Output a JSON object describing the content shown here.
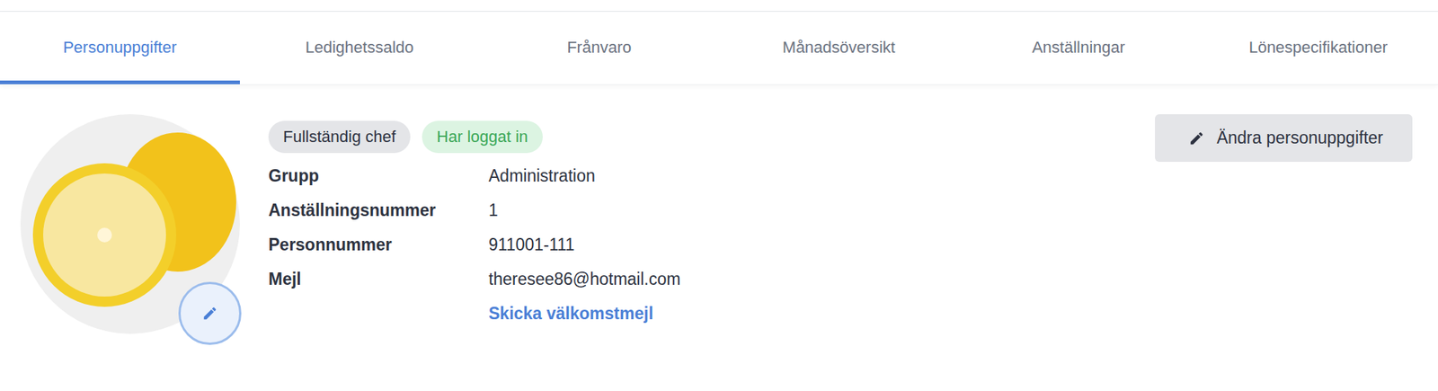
{
  "tabs": [
    {
      "label": "Personuppgifter",
      "selected": true
    },
    {
      "label": "Ledighetssaldo",
      "selected": false
    },
    {
      "label": "Frånvaro",
      "selected": false
    },
    {
      "label": "Månadsöversikt",
      "selected": false
    },
    {
      "label": "Anställningar",
      "selected": false
    },
    {
      "label": "Lönespecifikationer",
      "selected": false
    }
  ],
  "badges": [
    {
      "label": "Fullständig chef",
      "kind": "role"
    },
    {
      "label": "Har loggat in",
      "kind": "status"
    }
  ],
  "fields": [
    {
      "label": "Grupp",
      "value": "Administration"
    },
    {
      "label": "Anställningsnummer",
      "value": "1"
    },
    {
      "label": "Personnummer",
      "value": "911001-111"
    },
    {
      "label": "Mejl",
      "value": "theresee86@hotmail.com"
    }
  ],
  "welcome_link": "Skicka välkomstmejl",
  "edit_button": "Ändra personuppgifter"
}
